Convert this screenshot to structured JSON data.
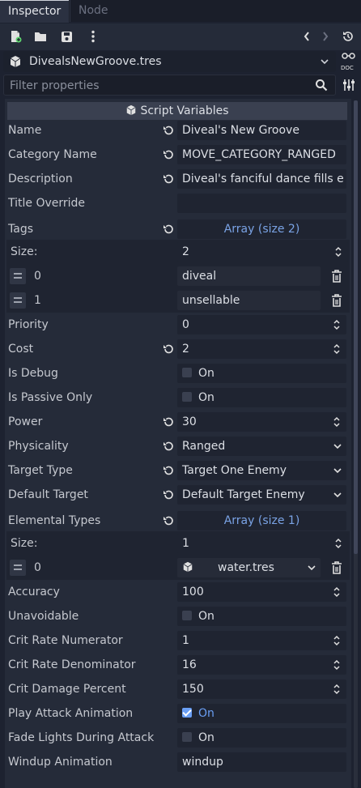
{
  "tabs": {
    "inspector": "Inspector",
    "node": "Node"
  },
  "resource": {
    "name": "DivealsNewGroove.tres"
  },
  "filter": {
    "placeholder": "Filter properties"
  },
  "section": {
    "title": "Script Variables"
  },
  "props": {
    "name": {
      "label": "Name",
      "value": "Diveal's New Groove"
    },
    "category": {
      "label": "Category Name",
      "value": "MOVE_CATEGORY_RANGED"
    },
    "description": {
      "label": "Description",
      "value": "Diveal's fanciful dance fills e"
    },
    "title_override": {
      "label": "Title Override",
      "value": ""
    },
    "tags": {
      "label": "Tags",
      "value": "Array (size 2)",
      "size_label": "Size:",
      "size": "2",
      "items": [
        {
          "index": "0",
          "value": "diveal"
        },
        {
          "index": "1",
          "value": "unsellable"
        }
      ]
    },
    "priority": {
      "label": "Priority",
      "value": "0"
    },
    "cost": {
      "label": "Cost",
      "value": "2"
    },
    "is_debug": {
      "label": "Is Debug",
      "value": "On"
    },
    "is_passive": {
      "label": "Is Passive Only",
      "value": "On"
    },
    "power": {
      "label": "Power",
      "value": "30"
    },
    "physicality": {
      "label": "Physicality",
      "value": "Ranged"
    },
    "target_type": {
      "label": "Target Type",
      "value": "Target One Enemy"
    },
    "default_target": {
      "label": "Default Target",
      "value": "Default Target Enemy"
    },
    "elemental": {
      "label": "Elemental Types",
      "value": "Array (size 1)",
      "size_label": "Size:",
      "size": "1",
      "items": [
        {
          "index": "0",
          "value": "water.tres"
        }
      ]
    },
    "accuracy": {
      "label": "Accuracy",
      "value": "100"
    },
    "unavoidable": {
      "label": "Unavoidable",
      "value": "On"
    },
    "crit_num": {
      "label": "Crit Rate Numerator",
      "value": "1"
    },
    "crit_den": {
      "label": "Crit Rate Denominator",
      "value": "16"
    },
    "crit_dmg": {
      "label": "Crit Damage Percent",
      "value": "150"
    },
    "play_attack": {
      "label": "Play Attack Animation",
      "value": "On"
    },
    "fade_lights": {
      "label": "Fade Lights During Attack",
      "value": "On"
    },
    "windup": {
      "label": "Windup Animation",
      "value": "windup"
    }
  },
  "colors": {
    "accent": "#6a9ff5",
    "link": "#7aa3e5",
    "panel": "#252b39",
    "field": "#1f2431"
  }
}
